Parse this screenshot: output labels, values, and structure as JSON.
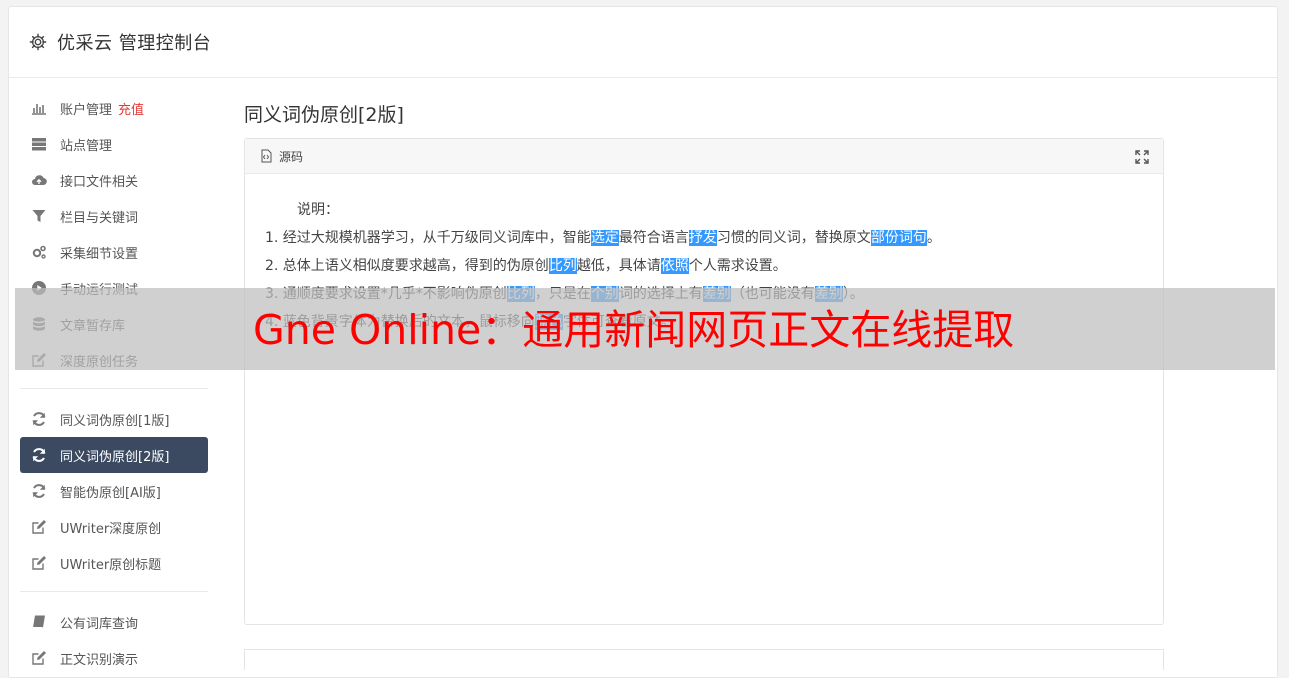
{
  "header": {
    "title": "优采云 管理控制台",
    "icon": "gear-icon"
  },
  "sidebar": {
    "recharge_label": "充值",
    "group1": [
      {
        "label": "账户管理",
        "icon": "bar-chart-icon"
      },
      {
        "label": "站点管理",
        "icon": "server-icon"
      },
      {
        "label": "接口文件相关",
        "icon": "cloud-upload-icon"
      },
      {
        "label": "栏目与关键词",
        "icon": "filter-icon"
      },
      {
        "label": "采集细节设置",
        "icon": "gears-icon"
      },
      {
        "label": "手动运行测试",
        "icon": "play-circle-icon"
      },
      {
        "label": "文章暂存库",
        "icon": "database-icon"
      },
      {
        "label": "深度原创任务",
        "icon": "edit-icon"
      }
    ],
    "group2": [
      {
        "label": "同义词伪原创[1版]",
        "icon": "refresh-icon"
      },
      {
        "label": "同义词伪原创[2版]",
        "icon": "refresh-icon",
        "active": true
      },
      {
        "label": "智能伪原创[AI版]",
        "icon": "refresh-icon"
      },
      {
        "label": "UWriter深度原创",
        "icon": "edit-icon"
      },
      {
        "label": "UWriter原创标题",
        "icon": "edit-icon"
      }
    ],
    "group3": [
      {
        "label": "公有词库查询",
        "icon": "book-icon"
      },
      {
        "label": "正文识别演示",
        "icon": "edit-icon"
      }
    ]
  },
  "main": {
    "title": "同义词伪原创[2版]",
    "panel_label": "源码",
    "content": {
      "intro": "说明：",
      "lines": [
        [
          "1. 经过大规模机器学习，从千万级同义词库中，智能",
          {
            "hl": "选定"
          },
          "最符合语言",
          {
            "hl": "抒发"
          },
          "习惯的同义词，替换原文",
          {
            "hl": "部份"
          },
          {
            "hl": "词句"
          },
          "。"
        ],
        [
          "2. 总体上语义相似度要求越高，得到的伪原创",
          {
            "hl": "比列"
          },
          "越低，具体请",
          {
            "hl": "依照"
          },
          "个人需求设置。"
        ],
        [
          "3. 通顺度要求设置*几乎*不影响伪原创",
          {
            "hl": "比列"
          },
          "，只是在",
          {
            "hl": "个别"
          },
          "词的选择上有",
          {
            "hl": "差别"
          },
          "（也可能没有",
          {
            "hl": "差别"
          },
          "）。"
        ],
        [
          "4. 蓝色背景字体为替换后的文本，鼠标移向",
          {
            "hl": "蓝色"
          },
          "字体可查看原文。"
        ]
      ]
    }
  },
  "banner": {
    "text": "Gne Online：通用新闻网页正文在线提取"
  }
}
